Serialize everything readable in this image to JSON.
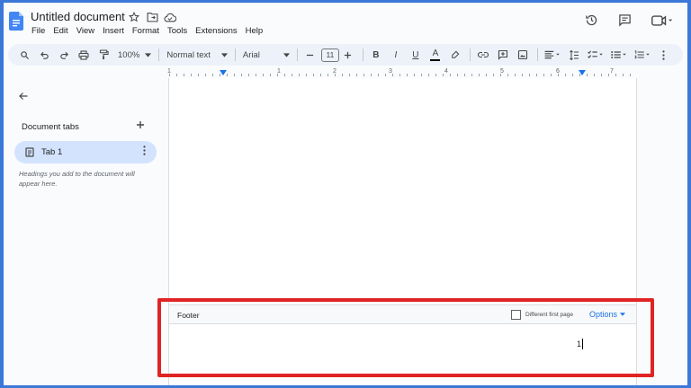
{
  "app": {
    "title": "Untitled document",
    "brand_color": "#1a73e8",
    "highlight_color": "#e02424"
  },
  "menu": [
    "File",
    "Edit",
    "View",
    "Insert",
    "Format",
    "Tools",
    "Extensions",
    "Help"
  ],
  "toolbar": {
    "zoom": "100%",
    "style": "Normal text",
    "font": "Arial",
    "font_size": "11",
    "bold": "B",
    "italic": "I",
    "underline": "U",
    "text_color": "A"
  },
  "ruler": {
    "numbers": [
      "1",
      "1",
      "2",
      "3",
      "4",
      "5",
      "6",
      "7"
    ]
  },
  "sidebar": {
    "tabs_title": "Document tabs",
    "tab_label": "Tab 1",
    "hint": "Headings you add to the document will appear here."
  },
  "footer": {
    "label": "Footer",
    "different_first_page": "Different first page",
    "options": "Options",
    "page_number": "1"
  },
  "icons": {
    "logo": "google-docs-icon",
    "star": "star-icon",
    "folder": "move-folder-icon",
    "cloud": "cloud-saved-icon",
    "history": "history-icon",
    "comment": "comment-icon",
    "meet": "video-call-icon"
  }
}
